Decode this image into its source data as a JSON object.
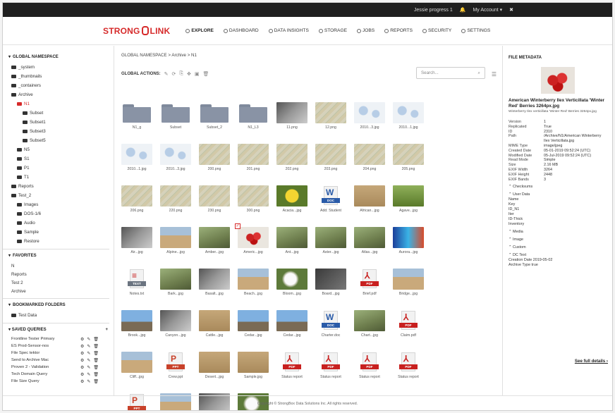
{
  "topbar": {
    "user": "Jessie progress 1",
    "bell": "bell-icon",
    "account": "My Account",
    "account_caret": "▾",
    "signout": "✖"
  },
  "brand": {
    "strong": "STRONG",
    "link": "LINK"
  },
  "nav": [
    {
      "label": "EXPLORE",
      "active": true
    },
    {
      "label": "DASHBOARD"
    },
    {
      "label": "DATA INSIGHTS"
    },
    {
      "label": "STORAGE"
    },
    {
      "label": "JOBS"
    },
    {
      "label": "REPORTS"
    },
    {
      "label": "SECURITY"
    },
    {
      "label": "SETTINGS"
    }
  ],
  "sidebar": {
    "namespace_title": "GLOBAL NAMESPACE",
    "tree": [
      {
        "label": "_system",
        "depth": 1
      },
      {
        "label": "_thumbnails",
        "depth": 1
      },
      {
        "label": "_containers",
        "depth": 1
      },
      {
        "label": "Archive",
        "depth": 1,
        "open": true
      },
      {
        "label": "N1",
        "depth": 2,
        "selected": true
      },
      {
        "label": "Subset",
        "depth": 3
      },
      {
        "label": "Subset1",
        "depth": 3
      },
      {
        "label": "Subset3",
        "depth": 3
      },
      {
        "label": "Subset5",
        "depth": 3
      },
      {
        "label": "N5",
        "depth": 2
      },
      {
        "label": "S1",
        "depth": 2
      },
      {
        "label": "P1",
        "depth": 2
      },
      {
        "label": "T1",
        "depth": 2
      },
      {
        "label": "Reports",
        "depth": 1
      },
      {
        "label": "Test_2",
        "depth": 1,
        "open": true
      },
      {
        "label": "Images",
        "depth": 2
      },
      {
        "label": "DOS-1/6",
        "depth": 2
      },
      {
        "label": "Audio",
        "depth": 2
      },
      {
        "label": "Sample",
        "depth": 2
      },
      {
        "label": "Restore",
        "depth": 2
      }
    ],
    "favorites_title": "FAVORITES",
    "favorites": [
      "N",
      "Reports",
      "Test 2",
      "Archive"
    ],
    "bookmarks_title": "BOOKMARKED FOLDERS",
    "bookmarks": [
      "Test Data"
    ],
    "saved_title": "SAVED QUERIES",
    "saved_add": "+",
    "saved": [
      "Frontline Tester Primary",
      "ES Prod-Sensor-nos",
      "File Spec tektor",
      "Send to Archive Mac",
      "Proven 2 - Validation",
      "Tech Domain Query",
      "File Size Query"
    ]
  },
  "main": {
    "breadcrumb": "GLOBAL NAMESPACE > Archive > N1",
    "actions_label": "GLOBAL ACTIONS:",
    "search_placeholder": "Search...",
    "files": [
      {
        "name": "N1_g",
        "kind": "folder"
      },
      {
        "name": "Subset",
        "kind": "folder"
      },
      {
        "name": "Subset_2",
        "kind": "folder"
      },
      {
        "name": "N1_L3",
        "kind": "folder"
      },
      {
        "name": "11.png",
        "kind": "photo3"
      },
      {
        "name": "12.png",
        "kind": "topo"
      },
      {
        "name": "2010...3.jpg",
        "kind": "world"
      },
      {
        "name": "2010...1.jpg",
        "kind": "world"
      },
      {
        "name": "2010...1.jpg",
        "kind": "world"
      },
      {
        "name": "2010...3.jpg",
        "kind": "world"
      },
      {
        "name": "200.png",
        "kind": "topo"
      },
      {
        "name": "201.png",
        "kind": "topo"
      },
      {
        "name": "202.png",
        "kind": "topo"
      },
      {
        "name": "203.png",
        "kind": "topo"
      },
      {
        "name": "204.png",
        "kind": "topo"
      },
      {
        "name": "205.png",
        "kind": "topo"
      },
      {
        "name": "206.png",
        "kind": "topo"
      },
      {
        "name": "220.png",
        "kind": "topo"
      },
      {
        "name": "230.png",
        "kind": "topo"
      },
      {
        "name": "300.png",
        "kind": "topo"
      },
      {
        "name": "Acacia...jpg",
        "kind": "flower"
      },
      {
        "name": "Add. Student",
        "kind": "word",
        "tag": "DOC"
      },
      {
        "name": "African...jpg",
        "kind": "sand"
      },
      {
        "name": "Agave...jpg",
        "kind": "green"
      },
      {
        "name": "Air...jpg",
        "kind": "photo3"
      },
      {
        "name": "Alpine...jpg",
        "kind": "photo2"
      },
      {
        "name": "Amber...jpg",
        "kind": "photo"
      },
      {
        "name": "Americ...jpg",
        "kind": "berry",
        "checked": true
      },
      {
        "name": "Ant...jpg",
        "kind": "photo"
      },
      {
        "name": "Aster...jpg",
        "kind": "photo"
      },
      {
        "name": "Atlas...jpg",
        "kind": "photo"
      },
      {
        "name": "Aurora...jpg",
        "kind": "blue"
      },
      {
        "name": "Notes.txt",
        "kind": "txt",
        "tag": "TEXT"
      },
      {
        "name": "Bark...jpg",
        "kind": "photo"
      },
      {
        "name": "Basalt...jpg",
        "kind": "photo3"
      },
      {
        "name": "Beach...jpg",
        "kind": "photo2"
      },
      {
        "name": "Bloom...jpg",
        "kind": "white"
      },
      {
        "name": "Board...jpg",
        "kind": "dark"
      },
      {
        "name": "Brief.pdf",
        "kind": "pdf",
        "tag": "PDF"
      },
      {
        "name": "Bridge...jpg",
        "kind": "photo2"
      },
      {
        "name": "Brook...jpg",
        "kind": "sky"
      },
      {
        "name": "Canyon...jpg",
        "kind": "photo3"
      },
      {
        "name": "Cattle...jpg",
        "kind": "sand"
      },
      {
        "name": "Cedar...jpg",
        "kind": "sky"
      },
      {
        "name": "Cedar...jpg",
        "kind": "sky"
      },
      {
        "name": "Charter.doc",
        "kind": "word",
        "tag": "DOC"
      },
      {
        "name": "Chart...jpg",
        "kind": "photo"
      },
      {
        "name": "Claim.pdf",
        "kind": "pdf",
        "tag": "PDF"
      },
      {
        "name": "Cliff...jpg",
        "kind": "photo2"
      },
      {
        "name": "Crew.ppt",
        "kind": "ppt",
        "tag": "PPT"
      },
      {
        "name": "Desert...jpg",
        "kind": "sand"
      },
      {
        "name": "Sample.jpg",
        "kind": "sand"
      },
      {
        "name": "Status report",
        "kind": "pdf",
        "tag": "PDF"
      },
      {
        "name": "Status report",
        "kind": "pdf",
        "tag": "PDF"
      },
      {
        "name": "Status report",
        "kind": "pdf",
        "tag": "PDF"
      },
      {
        "name": "Status report",
        "kind": "pdf",
        "tag": "PDF"
      },
      {
        "name": "Slides.ppt",
        "kind": "ppt",
        "tag": "PPT"
      },
      {
        "name": "Valley...jpg",
        "kind": "photo2"
      },
      {
        "name": "White...jpg",
        "kind": "photo3"
      },
      {
        "name": "White...jpg",
        "kind": "white"
      }
    ]
  },
  "metadata": {
    "title": "FILE METADATA",
    "file_title": "American Winterberry Ilex Verticillata 'Winter Red' Berries 3264px.jpg",
    "file_sub": "Winterberry Ilex verticillata 'Winter Red' Berries 3264px.jpg",
    "rows": [
      {
        "k": "Version",
        "v": "1"
      },
      {
        "k": "Replicated",
        "v": "True"
      },
      {
        "k": "ID",
        "v": "2310"
      },
      {
        "k": "Path",
        "v": "/Archive/N1/American Winterberry Ilex Verticillata.jpg"
      },
      {
        "k": "MIME Type",
        "v": "image/jpeg"
      },
      {
        "k": "Created Date",
        "v": "05-01-2019 09:52:24 (UTC)"
      },
      {
        "k": "Modified Date",
        "v": "05-Jul-2019 09:52:24 (UTC)"
      },
      {
        "k": "Read Mode",
        "v": "Simple"
      },
      {
        "k": "Size",
        "v": "2.16 MB"
      },
      {
        "k": "EXIF Width",
        "v": "3264"
      },
      {
        "k": "EXIF Height",
        "v": "2448"
      },
      {
        "k": "EXIF Bands",
        "v": "3"
      }
    ],
    "group_checksums": "Checksums",
    "group_user": "User Data",
    "user_rows": [
      "Name",
      "Key",
      "ID_N1",
      "Iter",
      "ID-Thick",
      "Inventory"
    ],
    "group_media": "Media",
    "group_image": "Image",
    "group_custom": "Custom",
    "group_dc": "DC Text",
    "dc_rows": [
      "Creation Date 2019-05-02",
      "Archive Type true"
    ],
    "see_full": "See full details ›"
  },
  "footer": "Copyright © StrongBox Data Solutions Inc. All rights reserved."
}
